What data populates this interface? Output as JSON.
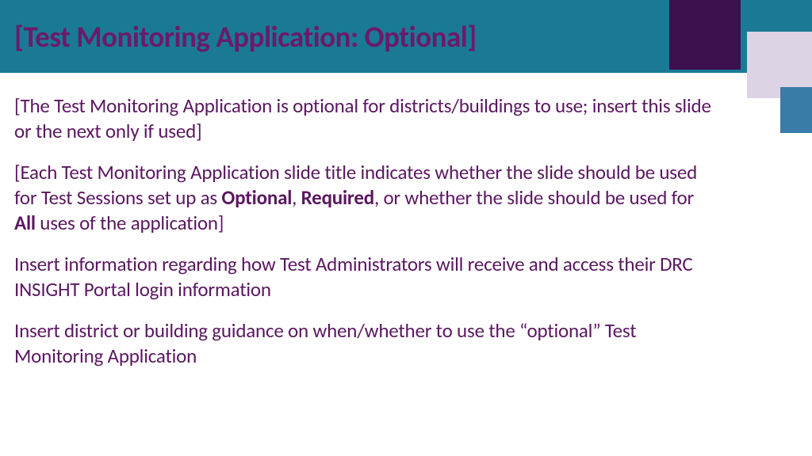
{
  "header": {
    "title": "[Test Monitoring Application: Optional]"
  },
  "content": {
    "p1": "[The Test Monitoring Application is optional for districts/buildings to use; insert this slide or the next only if used]",
    "p2_a": "[Each Test Monitoring Application slide title indicates whether the slide should be used for Test Sessions set up as ",
    "p2_b1": "Optional",
    "p2_c": ", ",
    "p2_b2": "Required",
    "p2_d": ", or whether the slide should be used for ",
    "p2_b3": "All",
    "p2_e": " uses of the application]",
    "p3": "Insert information regarding how Test Administrators will receive and access their DRC INSIGHT Portal login information",
    "p4": "Insert district or building guidance on when/whether to use the “optional” Test Monitoring Application"
  },
  "colors": {
    "header_bg": "#1a7a96",
    "title_color": "#6a1b6a",
    "text_color": "#5a1760",
    "deco_dark": "#3d1150",
    "deco_lilac": "#dcd3e5",
    "deco_blue": "#3a7ca8"
  }
}
